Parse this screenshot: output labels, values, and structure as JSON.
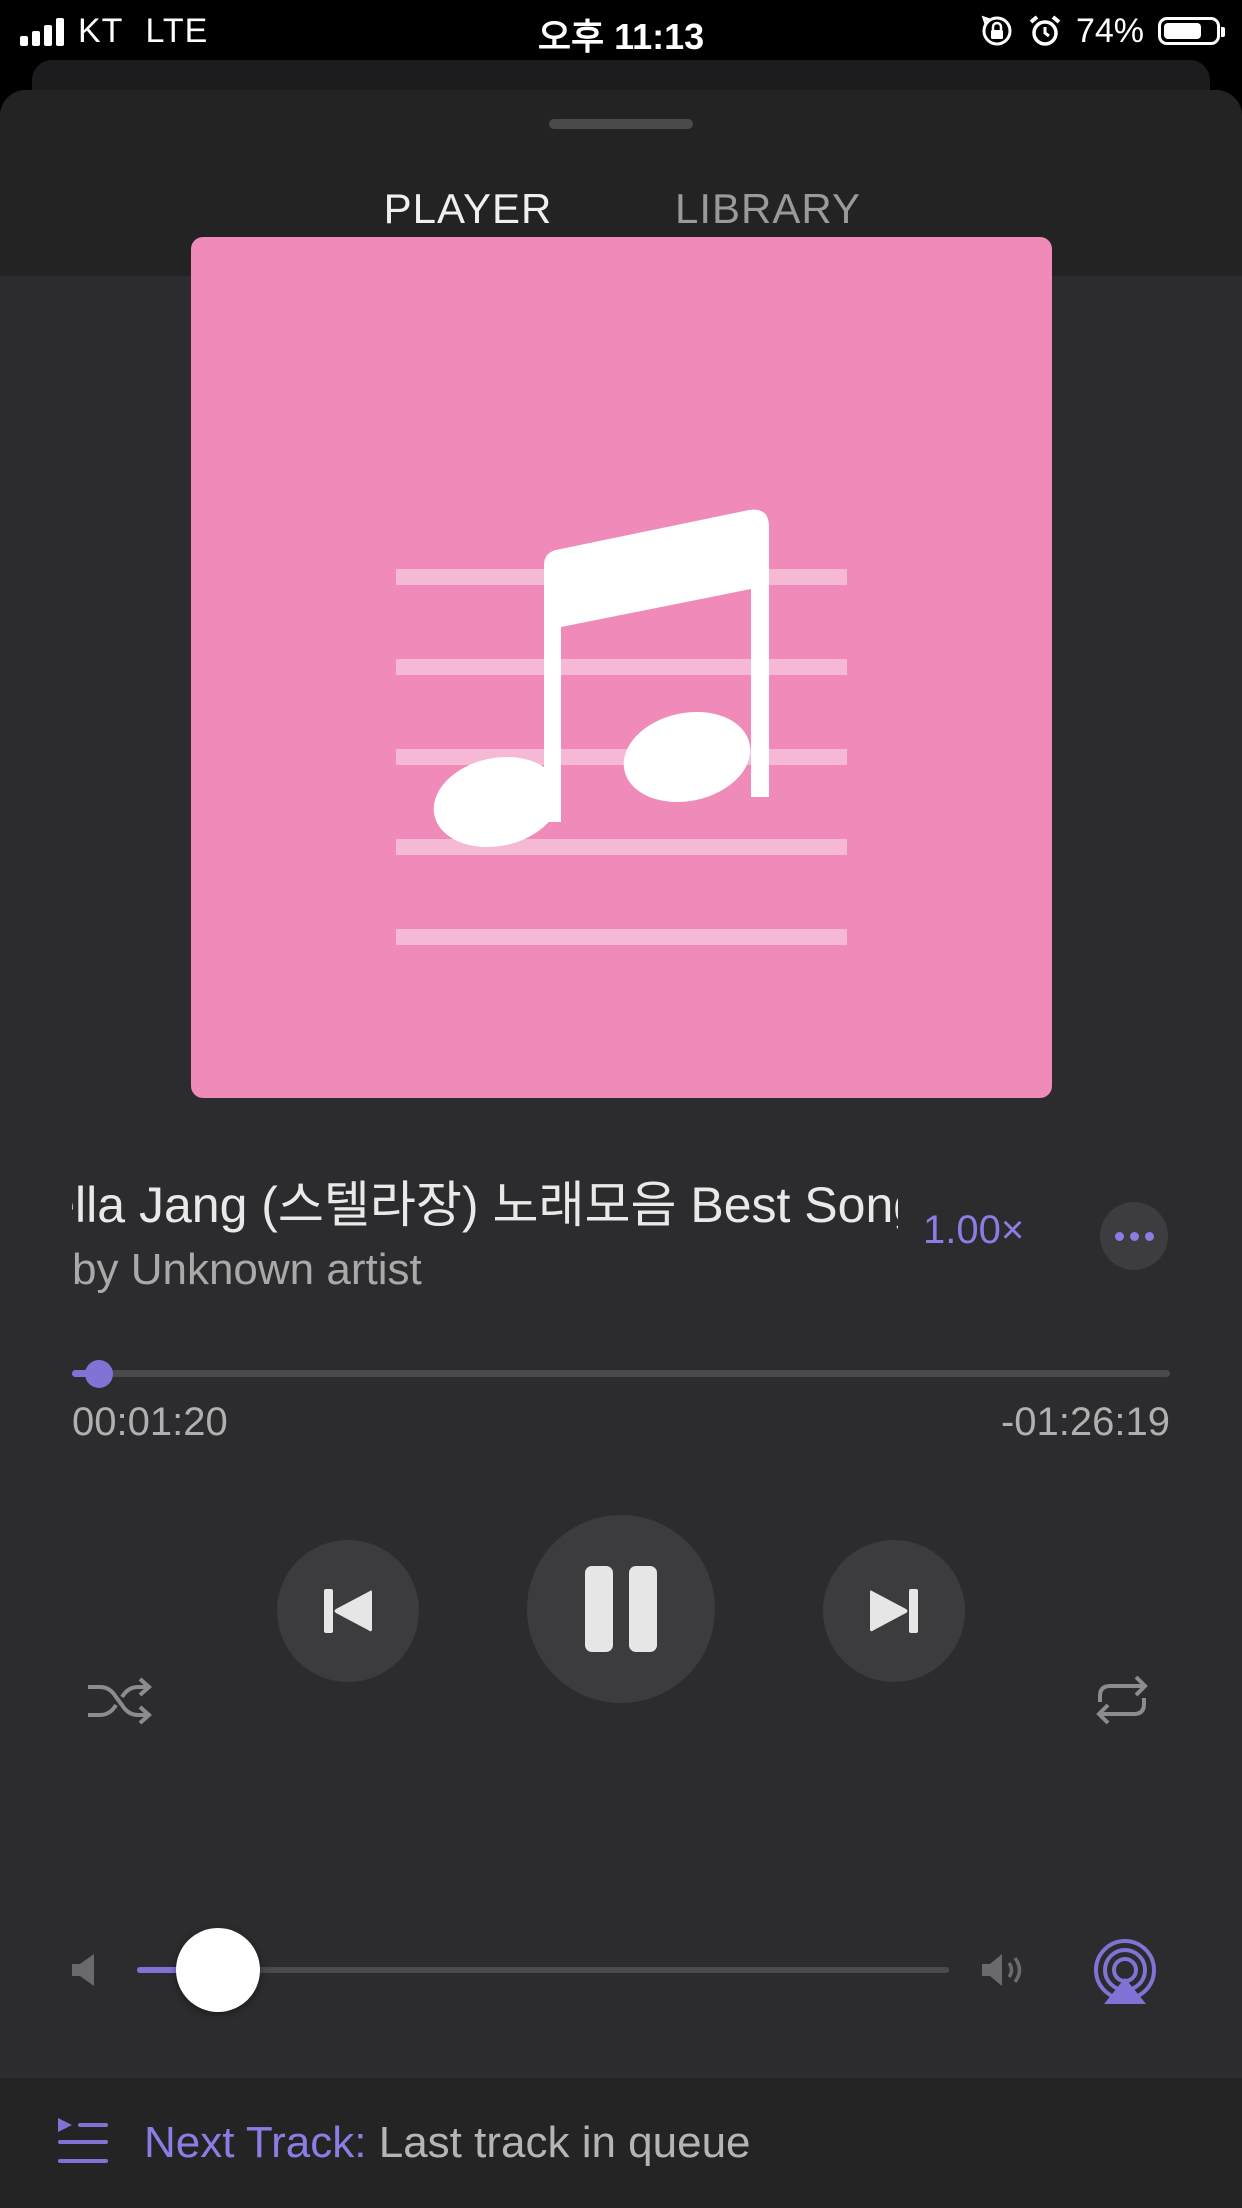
{
  "status_bar": {
    "carrier": "KT",
    "network": "LTE",
    "time": "오후 11:13",
    "battery": "74%",
    "battery_level": 0.74,
    "icons": [
      "signal-icon",
      "orientation-lock-icon",
      "alarm-icon",
      "battery-icon"
    ]
  },
  "tabs": [
    {
      "label": "PLAYER",
      "selected": true
    },
    {
      "label": "LIBRARY",
      "selected": false
    }
  ],
  "artwork": {
    "icon": "music-note-icon",
    "background": "#ef8ab9"
  },
  "track": {
    "title": "Stella Jang (스텔라장) 노래모음 Best Songs",
    "artist": "by Unknown artist",
    "speed": "1.00×"
  },
  "progress": {
    "elapsed": "00:01:20",
    "remaining": "-01:26:19",
    "fraction": 0.025
  },
  "controls": {
    "shuffle": "shuffle-icon",
    "previous": "skip-previous-icon",
    "play_pause": "pause-icon",
    "next": "skip-next-icon",
    "repeat": "repeat-icon"
  },
  "volume": {
    "level": 0.1
  },
  "next_track": {
    "label": "Next Track:",
    "value": "Last track in queue"
  },
  "colors": {
    "accent": "#7f74d6",
    "sheet": "#2c2c2e",
    "header": "#232323",
    "artwork": "#ef8ab9"
  }
}
